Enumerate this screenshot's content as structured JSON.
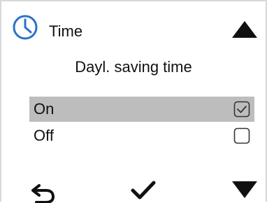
{
  "header": {
    "title": "Time",
    "icon": "clock-icon",
    "icon_color": "#2a72c8",
    "scroll_up_icon": "triangle-up-icon"
  },
  "screen": {
    "subtitle": "Dayl. saving time"
  },
  "options": [
    {
      "label": "On",
      "checked": true,
      "selected": true
    },
    {
      "label": "Off",
      "checked": false,
      "selected": false
    }
  ],
  "footer": {
    "back_icon": "back-arrow-icon",
    "confirm_icon": "checkmark-icon",
    "scroll_down_icon": "triangle-down-icon"
  },
  "colors": {
    "selection": "#bdbdbd",
    "accent": "#2a72c8"
  }
}
